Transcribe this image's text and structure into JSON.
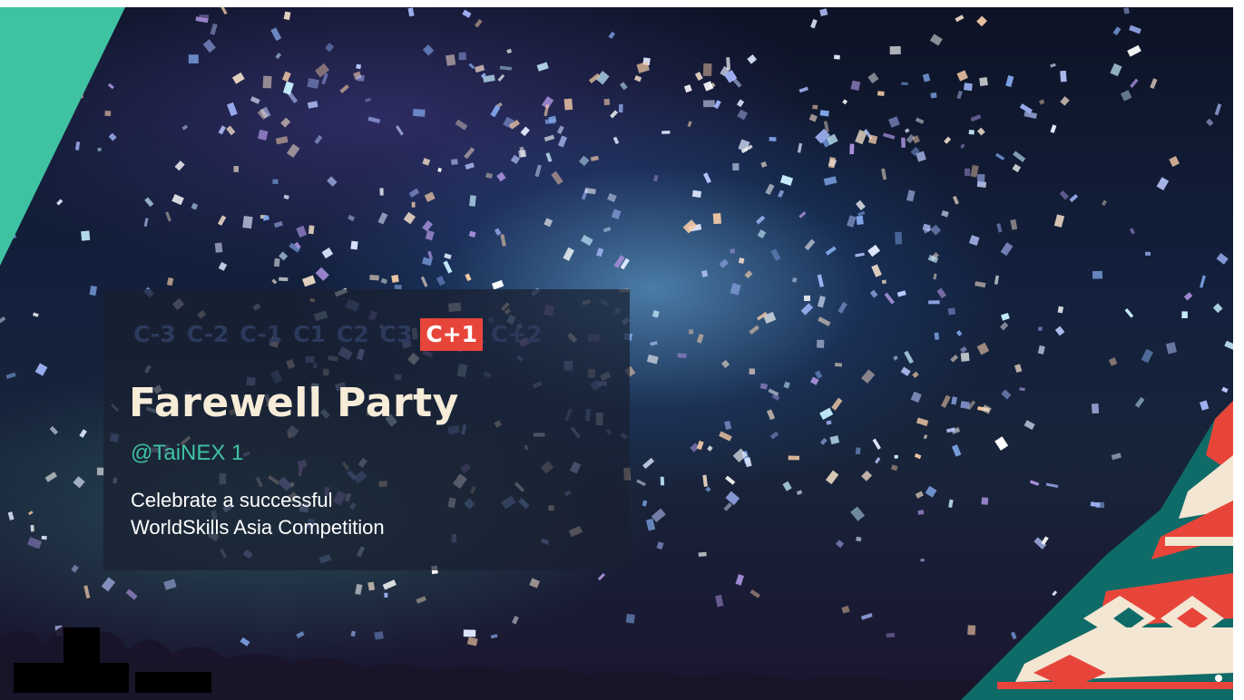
{
  "schedule": {
    "days": [
      "C-3",
      "C-2",
      "C-1",
      "C1",
      "C2",
      "C3",
      "C+1",
      "C+2"
    ],
    "active_day": "C+1"
  },
  "event": {
    "title": "Farewell Party",
    "venue": "@TaiNEX 1",
    "description_line1": "Celebrate a successful",
    "description_line2": "WorldSkills Asia Competition"
  },
  "colors": {
    "accent_teal": "#3fc2a2",
    "highlight_red": "#e8453a",
    "title_cream": "#f6ecd8"
  }
}
